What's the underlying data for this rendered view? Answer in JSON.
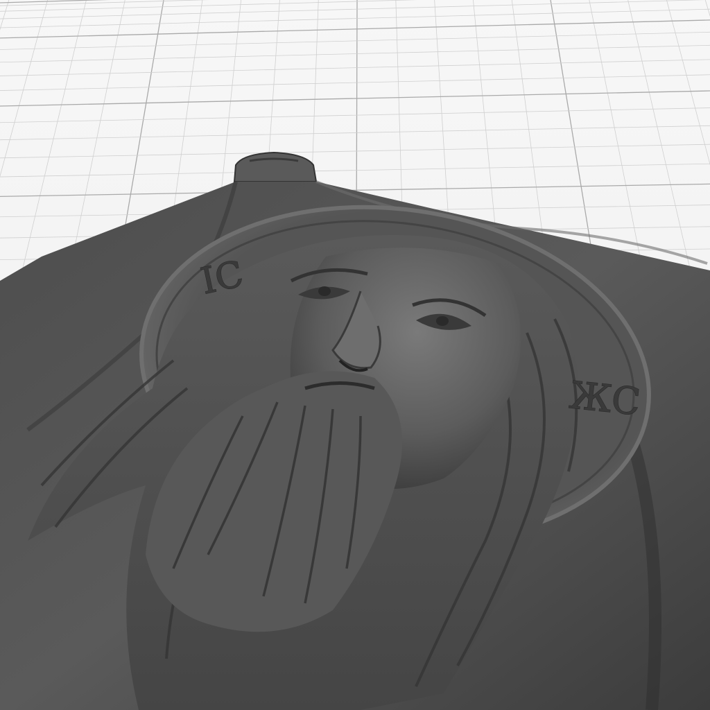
{
  "viewport": {
    "background_color": "#f4f4f4",
    "grid_minor_color": "#cfcfcf",
    "grid_major_color": "#a9a9a9",
    "model_color": "#5e5e5e",
    "model_shadow_color": "#2e2e2e",
    "model_highlight_color": "#8a8a8a"
  },
  "model": {
    "inscription_left": "IC",
    "inscription_right": "ЖС"
  }
}
